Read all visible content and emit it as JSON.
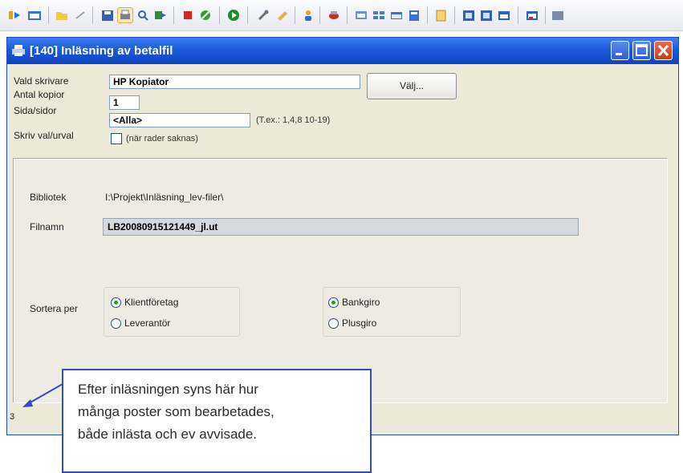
{
  "toolbar": {
    "icons": [
      "exit-icon",
      "window-icon",
      "open-icon",
      "refresh-icon",
      "save-icon",
      "print-preview-icon",
      "zoom-icon",
      "export-icon",
      "stop-icon",
      "cancel-icon",
      "run-icon",
      "tools-icon",
      "edit-icon",
      "person-icon",
      "record-icon",
      "layout-icon",
      "grid-icon",
      "window-list-icon",
      "calculator-icon",
      "document-icon",
      "help-icon",
      "help-context-icon",
      "dialog-icon",
      "minimize-all-icon",
      "close-all-icon"
    ]
  },
  "window": {
    "title": "[140]  Inläsning av betalfil"
  },
  "form": {
    "printer_label": "Vald skrivare",
    "printer_value": "HP Kopiator",
    "copies_label": "Antal kopior",
    "copies_value": "1",
    "pages_label": "Sida/sidor",
    "pages_value": "<Alla>",
    "pages_hint": "(T.ex.: 1,4,8 10-19)",
    "print_selection_label": "Skriv val/urval",
    "print_selection_hint": "(när rader saknas)",
    "choose_button": "Välj..."
  },
  "panel": {
    "library_label": "Bibliotek",
    "library_value": "I:\\Projekt\\Inläsning_lev-filer\\",
    "filename_label": "Filnamn",
    "filename_value": "LB20080915121449_jl.ut",
    "sort_label": "Sortera per",
    "sort_group1": [
      {
        "label": "Klientföretag",
        "selected": true
      },
      {
        "label": "Leverantör",
        "selected": false
      }
    ],
    "sort_group2": [
      {
        "label": "Bankgiro",
        "selected": true
      },
      {
        "label": "Plusgiro",
        "selected": false
      }
    ]
  },
  "status": {
    "count": "3"
  },
  "callout": {
    "lines": [
      "Efter inläsningen syns här hur",
      "många poster som bearbetades,",
      "både inlästa och ev avvisade."
    ]
  }
}
